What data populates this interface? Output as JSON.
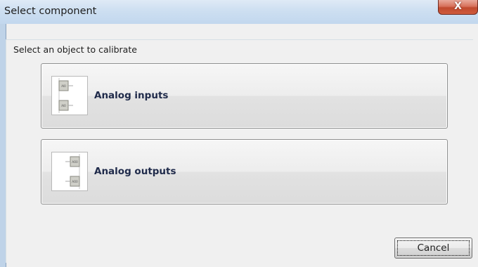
{
  "window": {
    "title": "Select component",
    "close_glyph": "X"
  },
  "dialog": {
    "prompt": "Select an object to calibrate",
    "options": [
      {
        "label": "Analog inputs",
        "icon": "analog-inputs-icon",
        "icon_tags": [
          "AI0",
          "AI0"
        ]
      },
      {
        "label": "Analog outputs",
        "icon": "analog-outputs-icon",
        "icon_tags": [
          "AO0",
          "AO0"
        ]
      }
    ],
    "cancel_label": "Cancel"
  },
  "colors": {
    "titlebar": "#c2d7ee",
    "client_background": "#f0f0f0",
    "close_button": "#c04a2e",
    "option_label": "#1f2a4a"
  }
}
